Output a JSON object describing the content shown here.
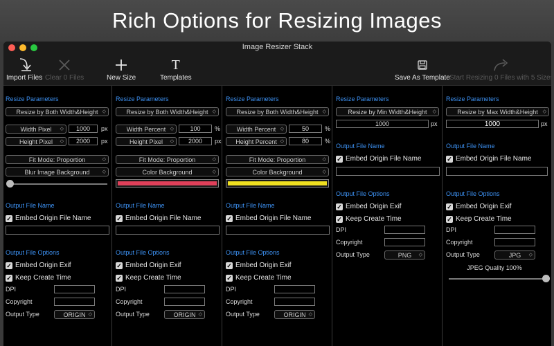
{
  "banner": {
    "title": "Rich Options for Resizing Images"
  },
  "window": {
    "title": "Image Resizer Stack"
  },
  "toolbar": {
    "import": "Import Files",
    "clear": "Clear 0 Files",
    "new_size": "New Size",
    "templates": "Templates",
    "save_template": "Save As Template",
    "start": "Start Resizing 0 Files with 5 Sizes"
  },
  "labels": {
    "resize_params": "Resize Parameters",
    "output_name": "Output File Name",
    "embed_name": "Embed Origin File Name",
    "output_options": "Output File Options",
    "embed_exif": "Embed Origin Exif",
    "keep_time": "Keep Create Time",
    "dpi": "DPI",
    "copyright": "Copyright",
    "output_type": "Output Type",
    "px": "px",
    "pct": "%"
  },
  "colors": {
    "accent": "#3d91f2",
    "swatch_red": "#e0405a",
    "swatch_yellow": "#f0e020"
  },
  "columns": [
    {
      "mode": "Resize by Both Width&Height",
      "width_unit": "Width Pixel",
      "width_value": "1000",
      "width_suffix": "px",
      "height_unit": "Height Pixel",
      "height_value": "2000",
      "height_suffix": "px",
      "fit_mode": "Fit Mode: Proportion",
      "background": "Blur Image Background",
      "output_type": "ORIGIN"
    },
    {
      "mode": "Resize by Both Width&Height",
      "width_unit": "Width Percent",
      "width_value": "100",
      "width_suffix": "%",
      "height_unit": "Height Pixel",
      "height_value": "2000",
      "height_suffix": "px",
      "fit_mode": "Fit Mode: Proportion",
      "background": "Color Background",
      "output_type": "ORIGIN"
    },
    {
      "mode": "Resize by Both Width&Height",
      "width_unit": "Width Percent",
      "width_value": "50",
      "width_suffix": "%",
      "height_unit": "Height Percent",
      "height_value": "80",
      "height_suffix": "%",
      "fit_mode": "Fit Mode: Proportion",
      "background": "Color Background",
      "output_type": "ORIGIN"
    },
    {
      "mode": "Resize by Min Width&Height",
      "size_value": "1000",
      "size_suffix": "px",
      "output_type": "PNG"
    },
    {
      "mode": "Resize by Max Width&Height",
      "size_value": "1000",
      "size_suffix": "px",
      "output_type": "JPG",
      "quality": "JPEG Quality 100%"
    }
  ]
}
